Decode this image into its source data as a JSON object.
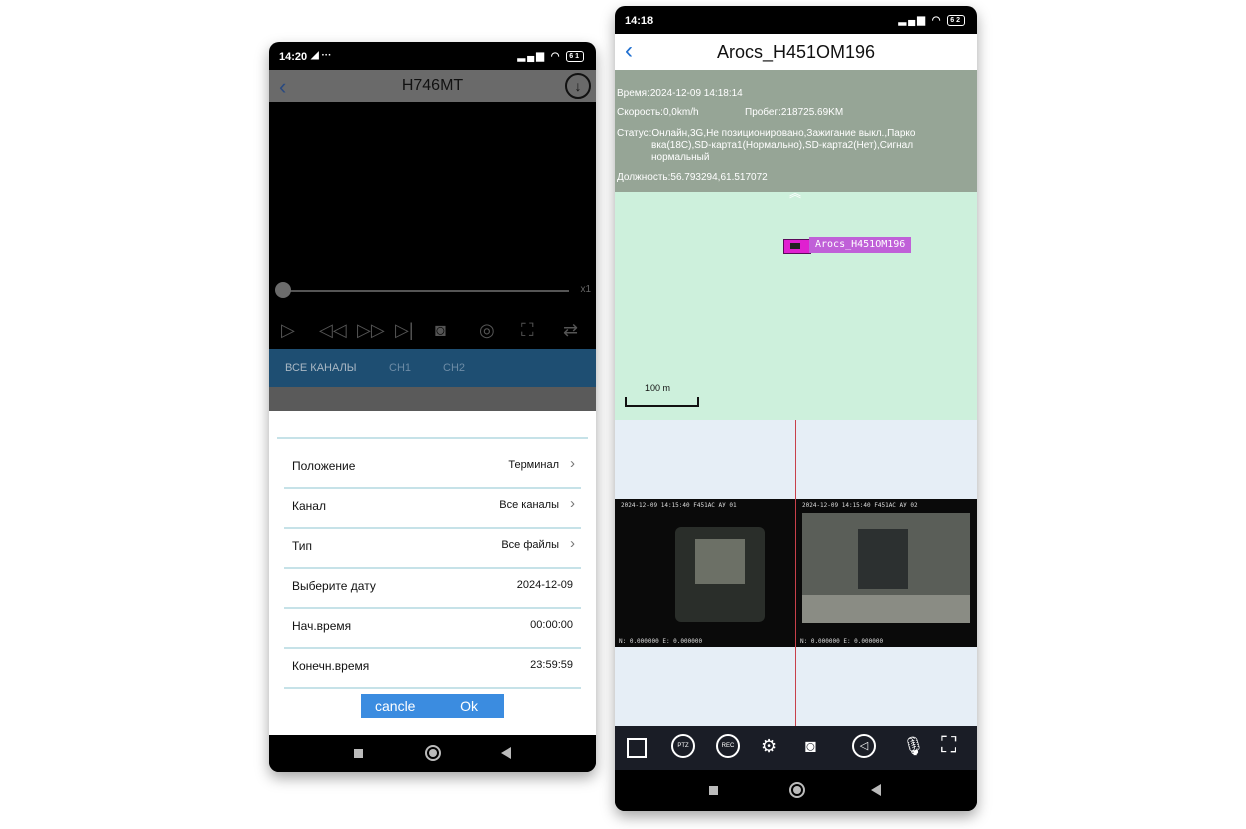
{
  "left_phone": {
    "status": {
      "time": "14:20",
      "extras": "◢ ···",
      "battery": "61"
    },
    "header": {
      "title": "Н746МТ",
      "back_icon": "chevron-left-icon",
      "download_icon": "download-icon"
    },
    "player": {
      "speed": "x1"
    },
    "tabs": [
      {
        "label": "ВСЕ КАНАЛЫ"
      },
      {
        "label": "CH1"
      },
      {
        "label": "CH2"
      }
    ],
    "form": {
      "rows": [
        {
          "label": "Положение",
          "value": "Терминал"
        },
        {
          "label": "Канал",
          "value": "Все каналы"
        },
        {
          "label": "Тип",
          "value": "Все файлы"
        },
        {
          "label": "Выберите дату",
          "value": "2024-12-09"
        },
        {
          "label": "Нач.время",
          "value": "00:00:00"
        },
        {
          "label": "Конечн.время",
          "value": "23:59:59"
        }
      ],
      "cancel_label": "cancle",
      "ok_label": "Ok"
    }
  },
  "right_phone": {
    "status": {
      "time": "14:18",
      "battery": "62"
    },
    "header": {
      "title": "Arocs_H451OM196"
    },
    "info": {
      "time": "Время:2024-12-09 14:18:14",
      "speed": "Скорость:0,0km/h",
      "mileage": "Пробег:218725.69KM",
      "status_line1": "Статус:Онлайн,3G,Не позиционировано,Зажигание выкл.,Парко",
      "status_line2": "вка(18С),SD-карта1(Нормально),SD-карта2(Нет),Сигнал",
      "status_line3": "нормальный",
      "coords": "Должность:56.793294,61.517072"
    },
    "map": {
      "marker_label": "Arocs_H451OM196",
      "scale_label": "100 m"
    },
    "video": {
      "cam1_osd": "2024-12-09 14:15:40       F451AC АУ 01",
      "cam1_osd2": "N: 0.000000 E: 0.000000",
      "cam2_osd": "2024-12-09 14:15:40       F451AC АУ 02",
      "cam2_osd2": "N: 0.000000 E: 0.000000"
    },
    "toolbar": {
      "ptz_label": "PTZ",
      "rec_label": "REC"
    }
  }
}
